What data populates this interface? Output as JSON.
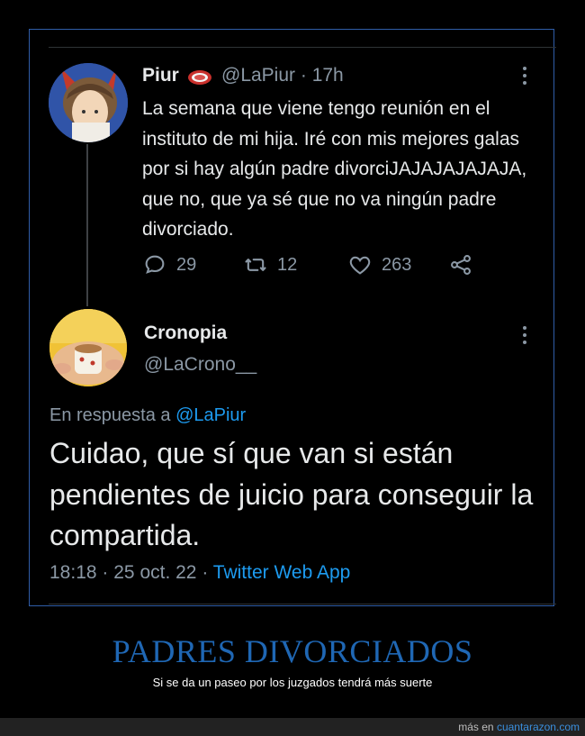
{
  "tweet": {
    "author_name": "Piur",
    "author_handle": "@LaPiur",
    "time_ago": "· 17h",
    "emoji_icon": "steak-icon",
    "text": "La semana que viene tengo reunión en el instituto de mi hija. Iré con mis mejores galas por si hay algún padre divorciJAJAJAJAJAJA, que no, que ya sé que no va ningún padre divorciado.",
    "replies": "29",
    "retweets": "12",
    "likes": "263"
  },
  "reply": {
    "author_name": "Cronopia",
    "author_handle": "@LaCrono__",
    "in_reply_prefix": "En respuesta a",
    "in_reply_mention": "@LaPiur",
    "text": "Cuidao, que sí que van si están pendientes de juicio para conseguir la compartida.",
    "time": "18:18",
    "date": "25 oct. 22",
    "app": "Twitter Web App",
    "sep": "·"
  },
  "caption": {
    "title": "PADRES DIVORCIADOS",
    "subtitle": "Si se da un paseo por los juzgados tendrá más suerte"
  },
  "footer": {
    "prefix": "más en",
    "site": "cuantarazon.com"
  },
  "colors": {
    "accent": "#1d9bf0",
    "headline": "#1f67b4",
    "muted": "#8b98a5",
    "frame": "#2f5da8"
  }
}
